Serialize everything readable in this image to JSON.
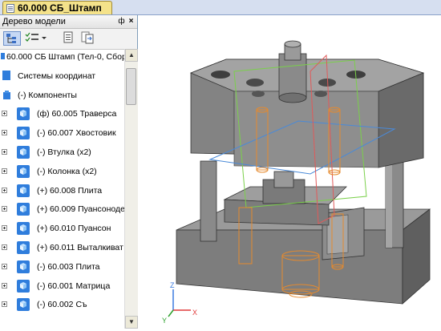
{
  "document": {
    "tab_title": "60.000 СБ_Штамп"
  },
  "panel": {
    "title": "Дерево модели",
    "pin_symbol": "ф",
    "close_symbol": "×"
  },
  "tree": {
    "items": [
      {
        "text": "60.000 СБ Штамп (Тел-0, Сбор",
        "icon": "assembly-icon",
        "expander": "none"
      },
      {
        "text": "Системы координат",
        "icon": "coordinate-system-icon",
        "expander": "none"
      },
      {
        "text": "(-) Компоненты",
        "icon": "components-folder-icon",
        "expander": "none"
      },
      {
        "text": "(ф) 60.005 Траверса",
        "icon": "part-cube-icon",
        "expander": "plus"
      },
      {
        "text": "(-) 60.007 Хвостовик",
        "icon": "part-cube-icon",
        "expander": "plus"
      },
      {
        "text": "(-) Втулка (x2)",
        "icon": "part-cube-icon",
        "expander": "plus"
      },
      {
        "text": "(-) Колонка (x2)",
        "icon": "part-cube-icon",
        "expander": "plus"
      },
      {
        "text": "(+) 60.008 Плита",
        "icon": "part-cube-icon",
        "expander": "plus"
      },
      {
        "text": "(+) 60.009 Пуансоноде",
        "icon": "part-cube-icon",
        "expander": "plus"
      },
      {
        "text": "(+) 60.010 Пуансон",
        "icon": "part-cube-icon",
        "expander": "plus"
      },
      {
        "text": "(+) 60.011 Выталкиват",
        "icon": "part-cube-icon",
        "expander": "plus"
      },
      {
        "text": "(-) 60.003 Плита",
        "icon": "part-cube-icon",
        "expander": "plus"
      },
      {
        "text": "(-) 60.001 Матрица",
        "icon": "part-cube-icon",
        "expander": "plus"
      },
      {
        "text": "(-) 60.002 Съ",
        "icon": "part-cube-icon",
        "expander": "plus"
      }
    ]
  },
  "viewport": {
    "axes": {
      "x": "X",
      "y": "Y",
      "z": "Z"
    }
  },
  "colors": {
    "tab_active": "#f4e28a",
    "part_icon": "#2f7ddc",
    "model_gray": "#8a8a8a",
    "hidden_lines": "#e58a2e",
    "plane_green": "#7ad04a",
    "plane_blue": "#4a8ad8",
    "plane_red": "#e05a5a"
  }
}
